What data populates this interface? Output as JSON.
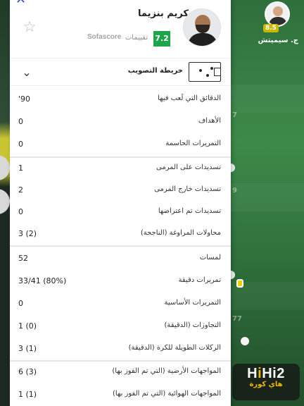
{
  "background": {
    "external_player": {
      "name": "ج. سيميتش",
      "rating": "8.5"
    },
    "pitch_numbers": [
      "7",
      "9",
      "77"
    ],
    "watermark": {
      "logo": "HiHi2",
      "sub": "هاي كورة"
    }
  },
  "panel": {
    "player_name": "كريم بنزيما",
    "rating": "7.2",
    "rating_label": "تقييمات",
    "rating_source": "Sofascore",
    "shotmap_label": "خريطة التصويب",
    "stats": [
      {
        "label": "الدقائق التي لَعب فيها",
        "value": "'90"
      },
      {
        "label": "الأهداف",
        "value": "0"
      },
      {
        "label": "التمريرات الحاسمة",
        "value": "0"
      },
      {
        "label": "تسديدات على المرمى",
        "value": "1"
      },
      {
        "label": "تسديدات خارج المرمى",
        "value": "2"
      },
      {
        "label": "تسديدات تم اعتراضها",
        "value": "0"
      },
      {
        "label": "محاولات المراوغة (الناجحة)",
        "value": "3 (2)"
      },
      {
        "label": "لمسات",
        "value": "52"
      },
      {
        "label": "تمريرات دقيقة",
        "value": "33/41 (80%)"
      },
      {
        "label": "التمريرات الأساسية",
        "value": "0"
      },
      {
        "label": "التجاوزات (الدقيقة)",
        "value": "1 (0)"
      },
      {
        "label": "الركلات الطويلة للكرة (الدقيقة)",
        "value": "3 (1)"
      },
      {
        "label": "المواجهات الأرضية (التي تم الفوز بها)",
        "value": "6 (3)"
      },
      {
        "label": "المواجهات الهوائية (التي تم الفوز بها)",
        "value": "1 (1)"
      }
    ]
  },
  "colors": {
    "rating_green": "#1ea44a",
    "ext_rating_yellow": "#c9b800",
    "accent_blue": "#2f4bd6"
  },
  "icons": [
    "close-icon",
    "star-icon",
    "chevron-down-icon",
    "pitch-icon"
  ]
}
